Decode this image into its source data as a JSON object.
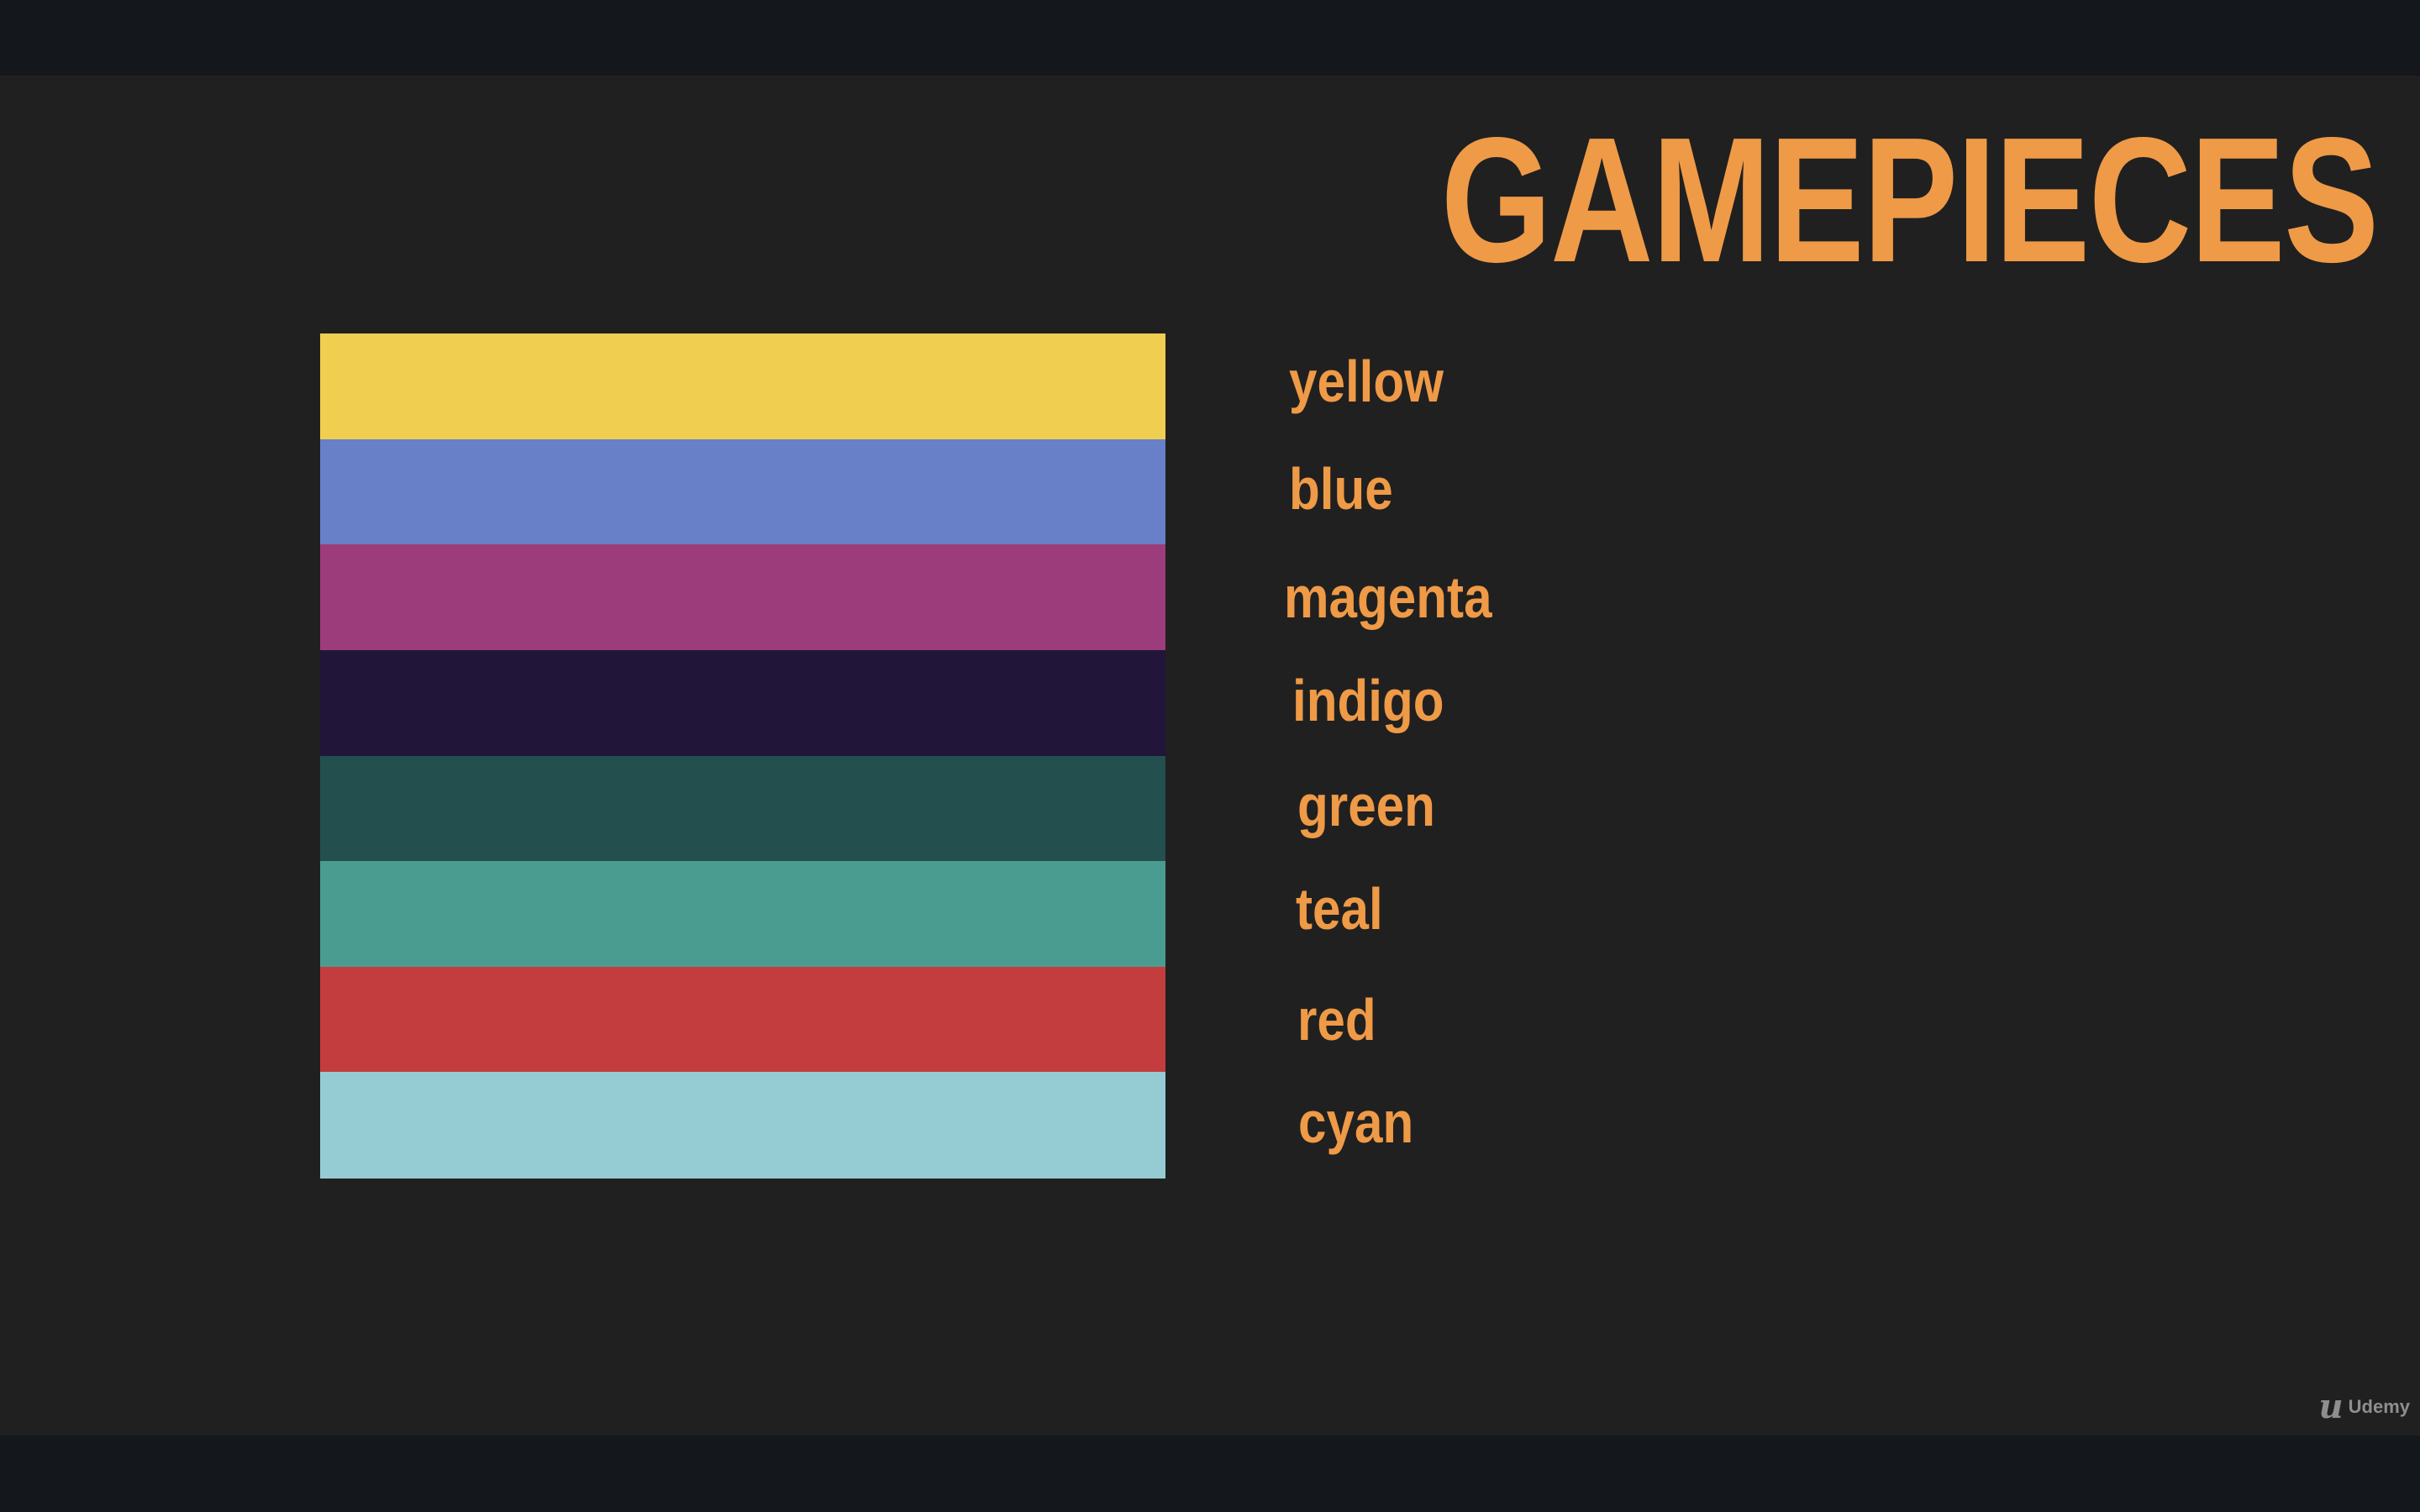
{
  "slide": {
    "title": "GAMEPIECES",
    "accent_color": "#ef9a47",
    "background_color": "#202020",
    "pieces": [
      {
        "label": "yellow",
        "color": "#f0ce4f"
      },
      {
        "label": "blue",
        "color": "#6880c8"
      },
      {
        "label": "magenta",
        "color": "#9c3c7a"
      },
      {
        "label": "indigo",
        "color": "#21153a"
      },
      {
        "label": "green",
        "color": "#244f4f"
      },
      {
        "label": "teal",
        "color": "#4a9c90"
      },
      {
        "label": "red",
        "color": "#c43d3e"
      },
      {
        "label": "cyan",
        "color": "#95ccd4"
      }
    ]
  },
  "brand": {
    "icon": "udemy-logo-icon",
    "name": "Udemy"
  }
}
